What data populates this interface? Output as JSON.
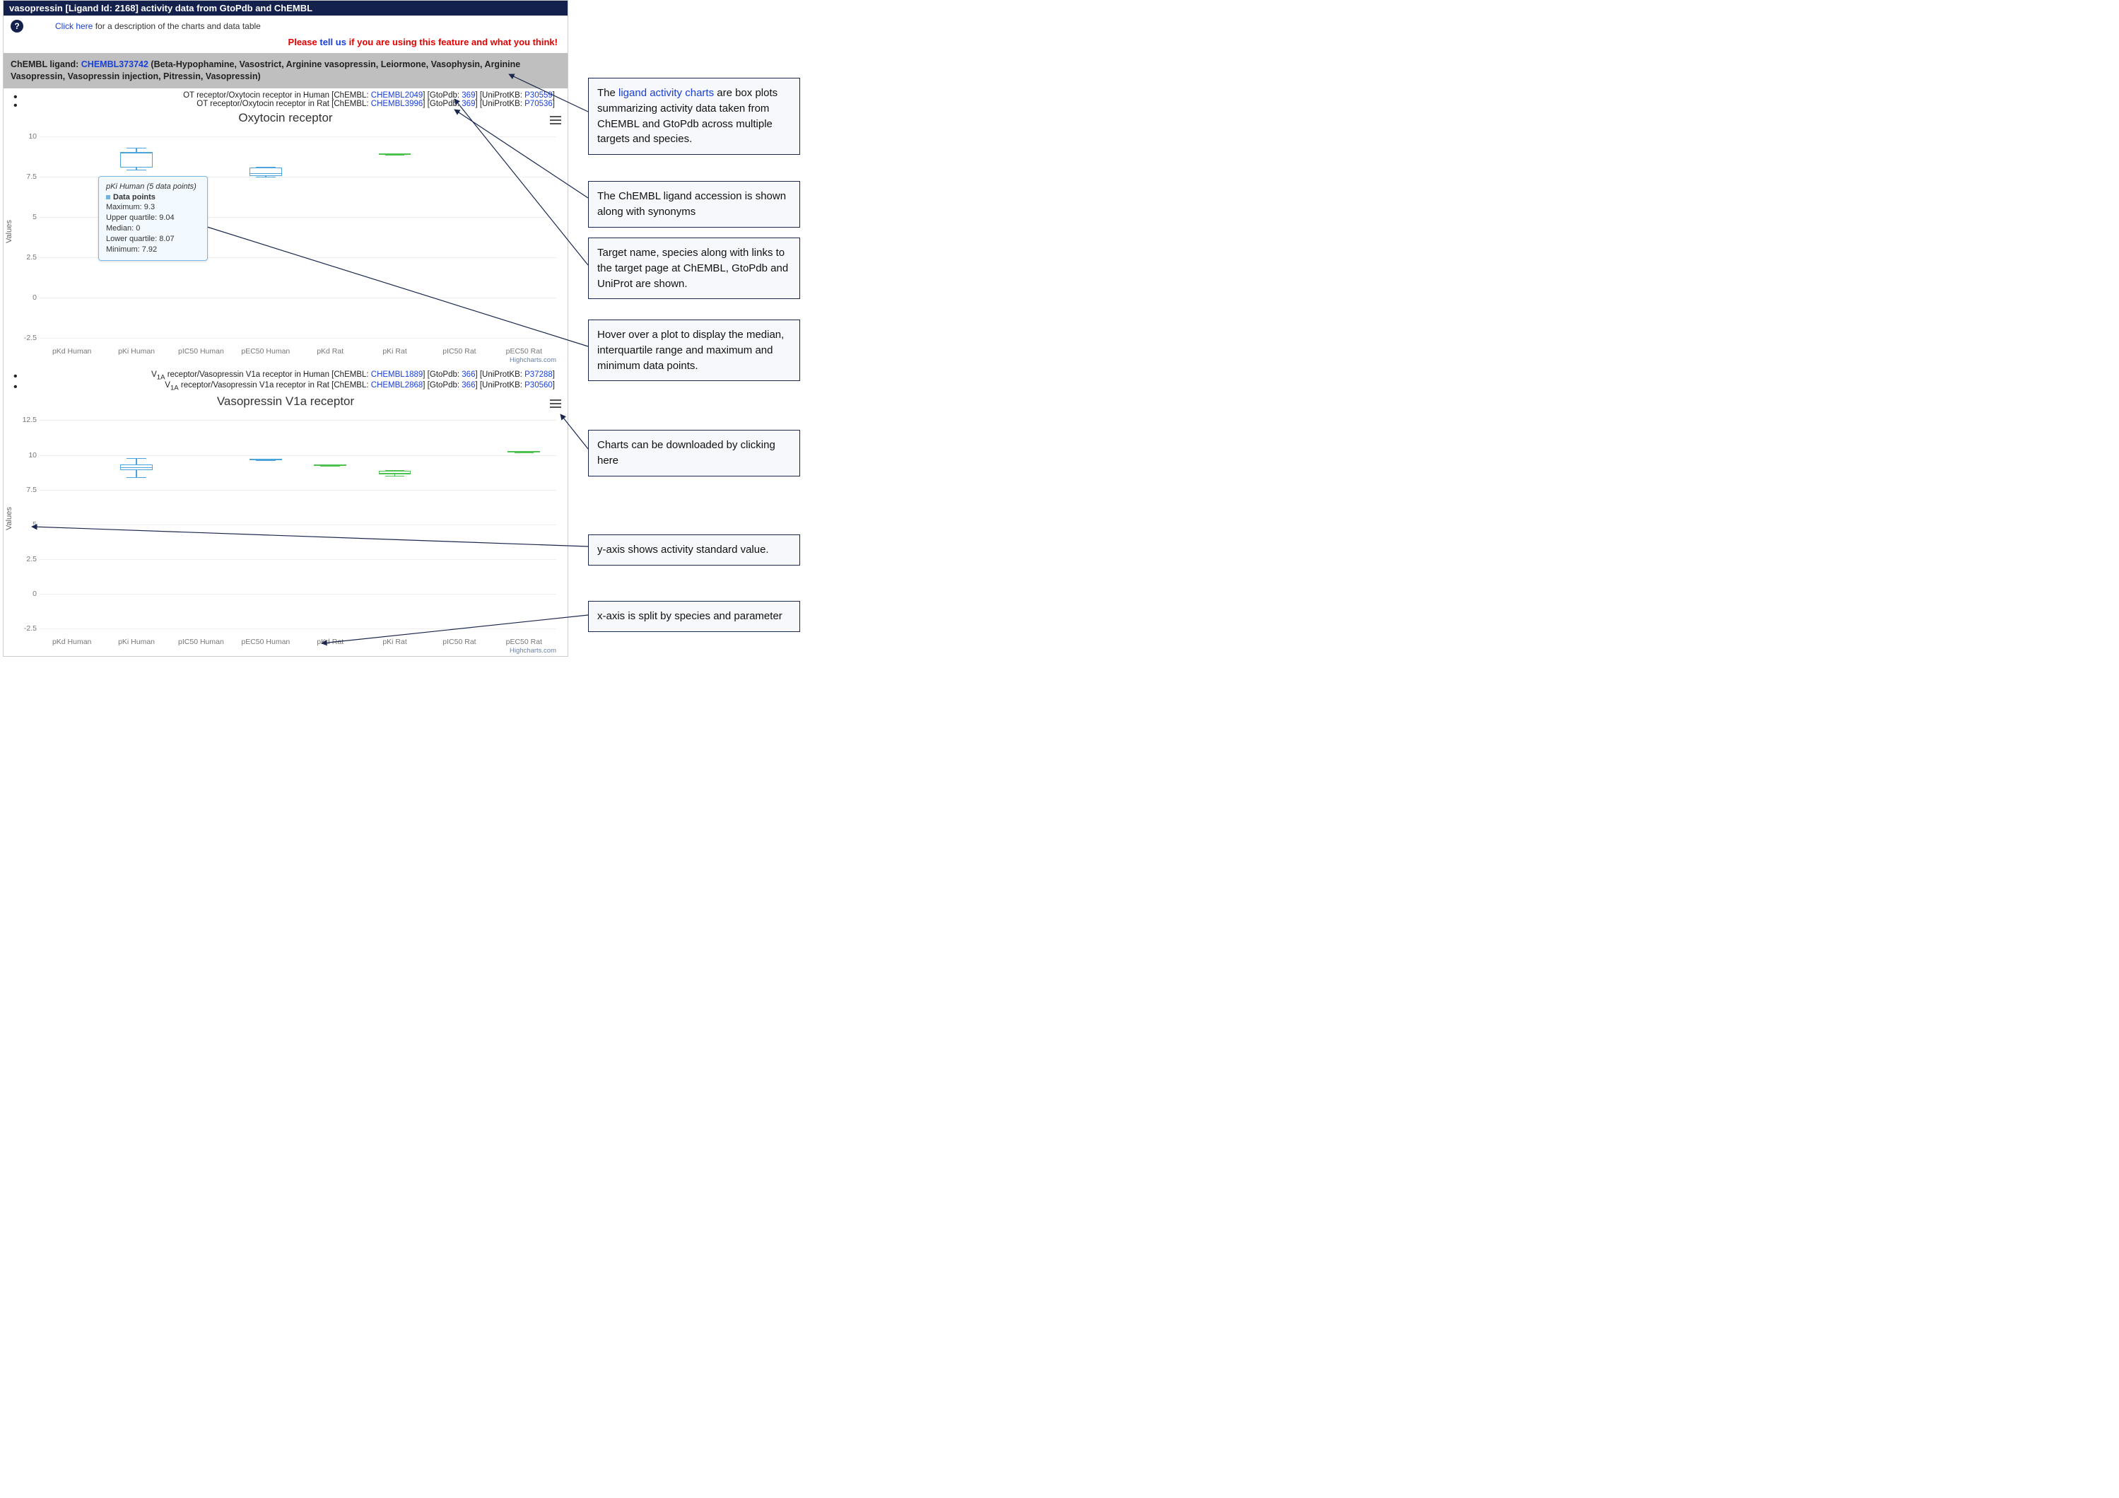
{
  "titlebar": "vasopressin [Ligand Id: 2168] activity data from GtoPdb and ChEMBL",
  "toprow": {
    "help_link_prefix": "Click here",
    "help_suffix": " for a description of the charts and data table"
  },
  "feedback": {
    "prefix": "Please ",
    "link": "tell us",
    "suffix": " if you are using this feature and what you think!"
  },
  "grayband": {
    "prefix": "ChEMBL ligand: ",
    "accession": "CHEMBL373742",
    "synonyms": " (Beta-Hypophamine, Vasostrict, Arginine vasopressin, Leiormone, Vasophysin, Arginine Vasopressin, Vasopressin injection, Pitressin, Vasopressin)"
  },
  "chart1": {
    "title": "Oxytocin receptor",
    "targets": [
      {
        "pre": "OT receptor/Oxytocin receptor in Human [ChEMBL: ",
        "chembl": "CHEMBL2049",
        "mid1": "] [GtoPdb: ",
        "gtopdb": "369",
        "mid2": "] [UniProtKB: ",
        "uni": "P30559",
        "end": "]"
      },
      {
        "pre": "OT receptor/Oxytocin receptor in Rat [ChEMBL: ",
        "chembl": "CHEMBL3996",
        "mid1": "] [GtoPdb: ",
        "gtopdb": "369",
        "mid2": "] [UniProtKB: ",
        "uni": "P70536",
        "end": "]"
      }
    ],
    "ylabel": "Values",
    "credit": "Highcharts.com"
  },
  "chart2": {
    "title": "Vasopressin V1a receptor",
    "targets": [
      {
        "pre_html": "V<sub>1A</sub> receptor/Vasopressin V1a receptor in Human [ChEMBL: ",
        "chembl": "CHEMBL1889",
        "mid1": "] [GtoPdb: ",
        "gtopdb": "366",
        "mid2": "] [UniProtKB: ",
        "uni": "P37288",
        "end": "]"
      },
      {
        "pre_html": "V<sub>1A</sub> receptor/Vasopressin V1a receptor in Rat [ChEMBL: ",
        "chembl": "CHEMBL2868",
        "mid1": "] [GtoPdb: ",
        "gtopdb": "366",
        "mid2": "] [UniProtKB: ",
        "uni": "P30560",
        "end": "]"
      }
    ],
    "ylabel": "Values",
    "credit": "Highcharts.com"
  },
  "tooltip": {
    "title": "pKi Human (5 data points)",
    "series": "Data points",
    "max_l": "Maximum: ",
    "max_v": "9.3",
    "uq_l": "Upper quartile: ",
    "uq_v": "9.04",
    "med_l": "Median: ",
    "med_v": "0",
    "lq_l": "Lower quartile: ",
    "lq_v": "8.07",
    "min_l": "Minimum: ",
    "min_v": "7.92"
  },
  "callouts": {
    "c1a": "The ",
    "c1link": "ligand activity charts",
    "c1b": " are box plots summarizing activity data taken from ChEMBL and GtoPdb across multiple targets and species.",
    "c2": "The ChEMBL ligand accession is shown along with synonyms",
    "c3": "Target name, species along with links to the target page at ChEMBL, GtoPdb and UniProt are shown.",
    "c4": "Hover over a plot to display the median, interquartile range and maximum and minimum data points.",
    "c5": "Charts can be downloaded by clicking here",
    "c6": "y-axis shows activity standard value.",
    "c7": "x-axis is split by species and parameter"
  },
  "chart_data": [
    {
      "type": "boxplot",
      "title": "Oxytocin receptor",
      "ylabel": "Values",
      "ylim": [
        -2.5,
        10
      ],
      "yticks": [
        -2.5,
        0,
        2.5,
        5,
        7.5,
        10
      ],
      "categories": [
        "pKd Human",
        "pKi Human",
        "pIC50 Human",
        "pEC50 Human",
        "pKd Rat",
        "pKi Rat",
        "pIC50 Rat",
        "pEC50 Rat"
      ],
      "series": [
        {
          "name": "Human",
          "color": "#4da3dc",
          "boxes": {
            "pKi Human": {
              "min": 7.92,
              "q1": 8.07,
              "median": 9.04,
              "q3": 9.04,
              "max": 9.3
            },
            "pEC50 Human": {
              "min": 7.5,
              "q1": 7.55,
              "median": 7.7,
              "q3": 8.05,
              "max": 8.1
            }
          }
        },
        {
          "name": "Rat",
          "color": "#4ec24e",
          "boxes": {
            "pKi Rat": {
              "min": 8.85,
              "q1": 8.85,
              "median": 8.9,
              "q3": 8.95,
              "max": 8.95
            }
          }
        }
      ]
    },
    {
      "type": "boxplot",
      "title": "Vasopressin V1a receptor",
      "ylabel": "Values",
      "ylim": [
        -2.5,
        12.5
      ],
      "yticks": [
        -2.5,
        0,
        2.5,
        5,
        7.5,
        10,
        12.5
      ],
      "categories": [
        "pKd Human",
        "pKi Human",
        "pIC50 Human",
        "pEC50 Human",
        "pKd Rat",
        "pKi Rat",
        "pIC50 Rat",
        "pEC50 Rat"
      ],
      "series": [
        {
          "name": "Human",
          "color": "#4da3dc",
          "boxes": {
            "pKi Human": {
              "min": 8.4,
              "q1": 8.9,
              "median": 9.1,
              "q3": 9.3,
              "max": 9.75
            },
            "pEC50 Human": {
              "min": 9.6,
              "q1": 9.6,
              "median": 9.65,
              "q3": 9.7,
              "max": 9.7
            }
          }
        },
        {
          "name": "Rat",
          "color": "#4ec24e",
          "boxes": {
            "pKd Rat": {
              "min": 9.2,
              "q1": 9.2,
              "median": 9.25,
              "q3": 9.3,
              "max": 9.3
            },
            "pKi Rat": {
              "min": 8.5,
              "q1": 8.6,
              "median": 8.7,
              "q3": 8.85,
              "max": 8.9
            },
            "pEC50 Rat": {
              "min": 10.2,
              "q1": 10.2,
              "median": 10.25,
              "q3": 10.3,
              "max": 10.3
            }
          }
        }
      ]
    }
  ]
}
